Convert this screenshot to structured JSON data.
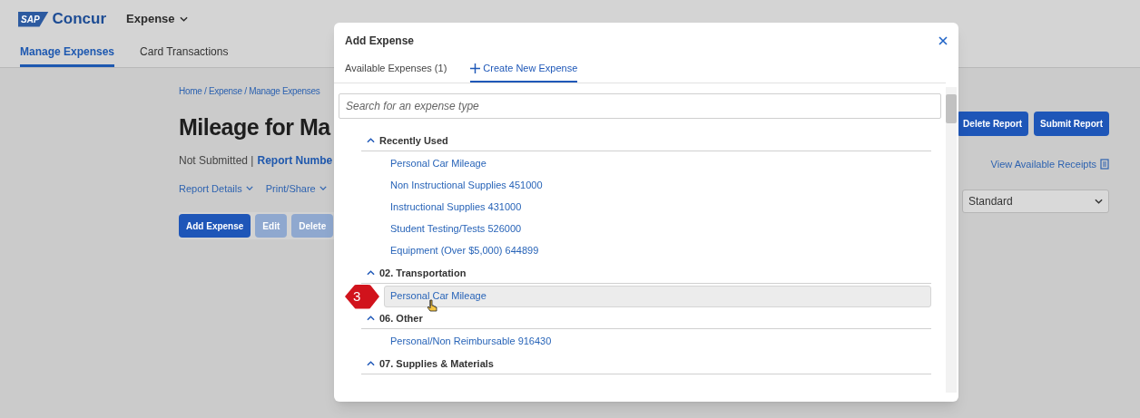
{
  "header": {
    "logo": {
      "mark": "SAP",
      "name": "Concur"
    },
    "app_menu": "Expense"
  },
  "nav_tabs": [
    {
      "label": "Manage Expenses",
      "selected": true
    },
    {
      "label": "Card Transactions",
      "selected": false
    }
  ],
  "report": {
    "breadcrumb": "Home / Expense / Manage Expenses",
    "title": "Mileage for Ma",
    "status": "Not Submitted |",
    "report_number": "Report Numbe",
    "menus": [
      "Report Details",
      "Print/Share"
    ],
    "actions": [
      {
        "label": "Add Expense",
        "disabled": false
      },
      {
        "label": "Edit",
        "disabled": true
      },
      {
        "label": "Delete",
        "disabled": true
      }
    ],
    "report_buttons": [
      "Delete Report",
      "Submit Report"
    ],
    "receipts_link": "View Available Receipts",
    "view_select": "Standard"
  },
  "dialog": {
    "title": "Add Expense",
    "tabs": [
      {
        "label": "Available Expenses (1)",
        "selected": false
      },
      {
        "label": "Create New Expense",
        "selected": true
      }
    ],
    "search": {
      "placeholder": "Search for an expense type"
    },
    "groups": [
      {
        "title": "Recently Used",
        "expanded": true,
        "items": [
          {
            "label": "Personal Car Mileage",
            "hovered": false
          },
          {
            "label": "Non Instructional Supplies 451000",
            "hovered": false
          },
          {
            "label": "Instructional Supplies 431000",
            "hovered": false
          },
          {
            "label": "Student Testing/Tests 526000",
            "hovered": false
          },
          {
            "label": "Equipment (Over $5,000) 644899",
            "hovered": false
          }
        ]
      },
      {
        "title": "02. Transportation",
        "expanded": true,
        "items": [
          {
            "label": "Personal Car Mileage",
            "hovered": true
          }
        ]
      },
      {
        "title": "06. Other",
        "expanded": true,
        "items": [
          {
            "label": "Personal/Non Reimbursable 916430",
            "hovered": false
          }
        ]
      },
      {
        "title": "07. Supplies & Materials",
        "expanded": true
      }
    ]
  },
  "callout": {
    "number": "3"
  }
}
